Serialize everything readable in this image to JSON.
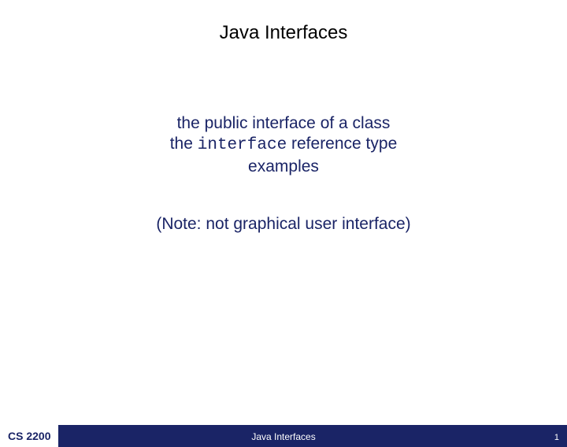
{
  "slide": {
    "title": "Java Interfaces",
    "line1": "the public interface of a class",
    "line2_pre": "the ",
    "line2_kw": "interface",
    "line2_post": " reference type",
    "line3": "examples",
    "note": "(Note: not graphical user interface)"
  },
  "footer": {
    "course": "CS 2200",
    "center": "Java Interfaces",
    "page": "1"
  }
}
